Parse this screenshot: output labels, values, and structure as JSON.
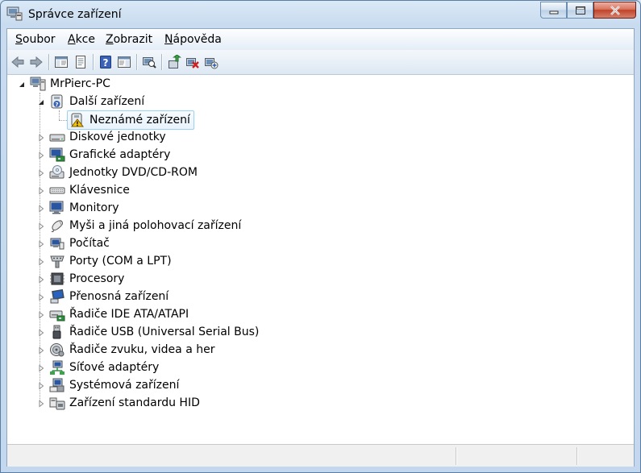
{
  "window": {
    "title": "Správce zařízení",
    "icon": "device-manager-icon"
  },
  "menu": [
    {
      "label": "Soubor",
      "accel": "S",
      "rest": "oubor"
    },
    {
      "label": "Akce",
      "accel": "A",
      "rest": "kce"
    },
    {
      "label": "Zobrazit",
      "accel": "Z",
      "rest": "obrazit"
    },
    {
      "label": "Nápověda",
      "accel": "N",
      "rest": "ápověda"
    }
  ],
  "toolbar": [
    "back-icon",
    "forward-icon",
    "show-hide-console-tree-icon",
    "properties-icon",
    "help-icon",
    "action-pane-icon",
    "scan-hardware-icon",
    "update-driver-icon",
    "uninstall-icon",
    "disable-icon"
  ],
  "tree": {
    "root": {
      "label": "MrPierc-PC",
      "icon": "computer-icon",
      "expanded": true
    },
    "categories": [
      {
        "label": "Další zařízení",
        "icon": "other-devices-icon",
        "expanded": true,
        "children": [
          {
            "label": "Neznámé zařízení",
            "icon": "unknown-device-warning-icon",
            "selected": true
          }
        ]
      },
      {
        "label": "Diskové jednotky",
        "icon": "disk-drive-icon"
      },
      {
        "label": "Grafické adaptéry",
        "icon": "display-adapter-icon"
      },
      {
        "label": "Jednotky DVD/CD-ROM",
        "icon": "dvd-drive-icon"
      },
      {
        "label": "Klávesnice",
        "icon": "keyboard-icon"
      },
      {
        "label": "Monitory",
        "icon": "monitor-icon"
      },
      {
        "label": "Myši a jiná polohovací zařízení",
        "icon": "mouse-icon"
      },
      {
        "label": "Počítač",
        "icon": "computer-small-icon"
      },
      {
        "label": "Porty (COM a LPT)",
        "icon": "port-icon"
      },
      {
        "label": "Procesory",
        "icon": "processor-icon"
      },
      {
        "label": "Přenosná zařízení",
        "icon": "portable-device-icon"
      },
      {
        "label": "Řadiče IDE ATA/ATAPI",
        "icon": "ide-controller-icon"
      },
      {
        "label": "Řadiče USB (Universal Serial Bus)",
        "icon": "usb-icon"
      },
      {
        "label": "Řadiče zvuku, videa a her",
        "icon": "sound-icon"
      },
      {
        "label": "Síťové adaptéry",
        "icon": "network-adapter-icon"
      },
      {
        "label": "Systémová zařízení",
        "icon": "system-device-icon"
      },
      {
        "label": "Zařízení standardu HID",
        "icon": "hid-icon"
      }
    ]
  },
  "colors": {
    "selection_border": "#9bd1f5",
    "close_button": "#c1432a",
    "frame": "#c3d8ee"
  }
}
